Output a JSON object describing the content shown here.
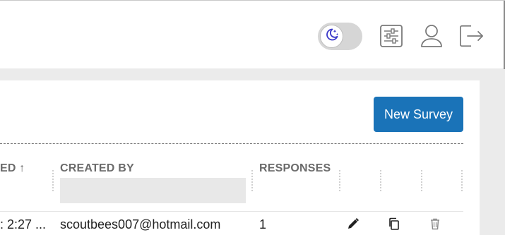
{
  "header": {
    "theme_toggle_icon": "moon-stars-icon",
    "settings_icon": "sliders-icon",
    "user_icon": "user-icon",
    "logout_icon": "logout-icon"
  },
  "toolbar": {
    "new_survey_label": "New Survey"
  },
  "table": {
    "columns": [
      {
        "label": "ED ↑"
      },
      {
        "label": "CREATED BY"
      },
      {
        "label": "RESPONSES"
      }
    ],
    "rows": [
      {
        "created": ": 2:27 ...",
        "created_by": "scoutbees007@hotmail.com",
        "responses": "1"
      }
    ],
    "row_actions": [
      "edit-icon",
      "copy-icon",
      "delete-icon"
    ]
  },
  "colors": {
    "accent": "#1a73b8",
    "background": "#ebebeb",
    "toggle_icon": "#3b39c9"
  }
}
